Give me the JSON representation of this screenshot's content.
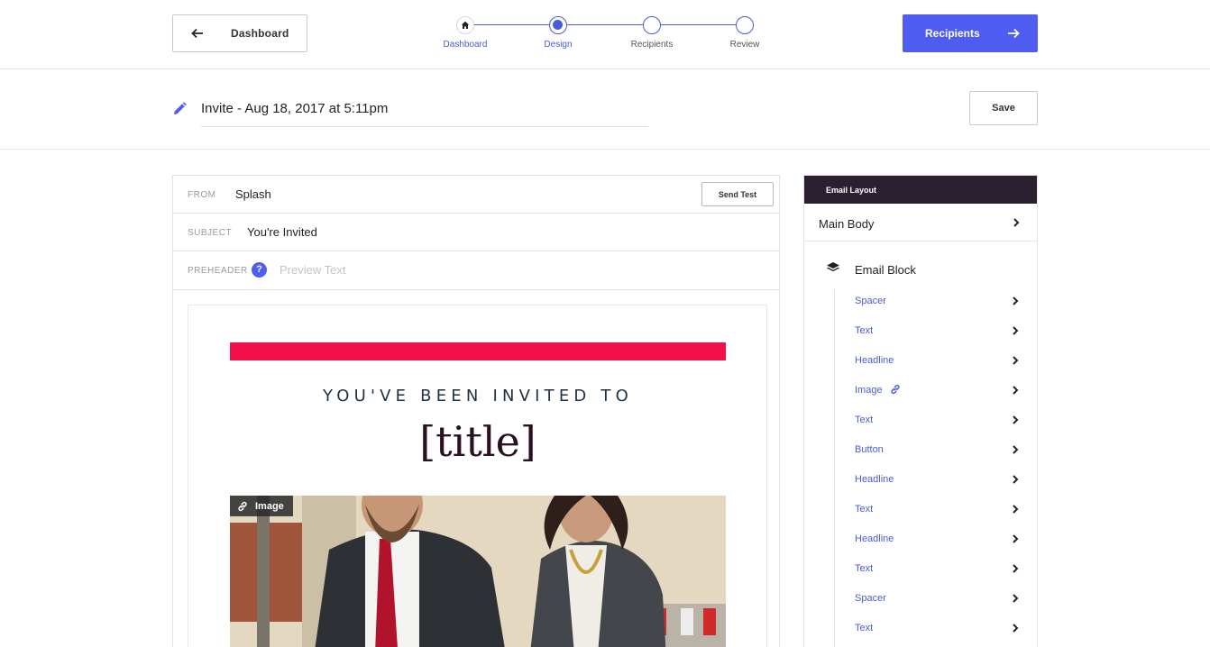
{
  "header": {
    "back_label": "Dashboard",
    "next_label": "Recipients",
    "steps": [
      {
        "label": "Dashboard",
        "state": "done",
        "icon": "home-icon"
      },
      {
        "label": "Design",
        "state": "current"
      },
      {
        "label": "Recipients",
        "state": "upcoming"
      },
      {
        "label": "Review",
        "state": "upcoming"
      }
    ]
  },
  "title_bar": {
    "title_value": "Invite - Aug 18, 2017 at 5:11pm",
    "save_label": "Save"
  },
  "email": {
    "from_label": "FROM",
    "from_value": "Splash",
    "send_test_label": "Send Test",
    "subject_label": "SUBJECT",
    "subject_value": "You're Invited",
    "preheader_label": "PREHEADER",
    "preheader_help": "?",
    "preheader_placeholder": "Preview Text",
    "invited_text": "YOU'VE BEEN INVITED TO",
    "title_text": "[title]",
    "image_tag": "Image"
  },
  "layout_panel": {
    "header": "Email Layout",
    "main_body": "Main Body",
    "block_title": "Email Block",
    "items": [
      {
        "label": "Spacer"
      },
      {
        "label": "Text"
      },
      {
        "label": "Headline"
      },
      {
        "label": "Image",
        "linked": true
      },
      {
        "label": "Text"
      },
      {
        "label": "Button"
      },
      {
        "label": "Headline"
      },
      {
        "label": "Text"
      },
      {
        "label": "Headline"
      },
      {
        "label": "Text"
      },
      {
        "label": "Spacer"
      },
      {
        "label": "Text"
      }
    ]
  },
  "colors": {
    "primary": "#4f5cf0",
    "accent_red": "#f1104a",
    "panel_header": "#2b2030"
  }
}
